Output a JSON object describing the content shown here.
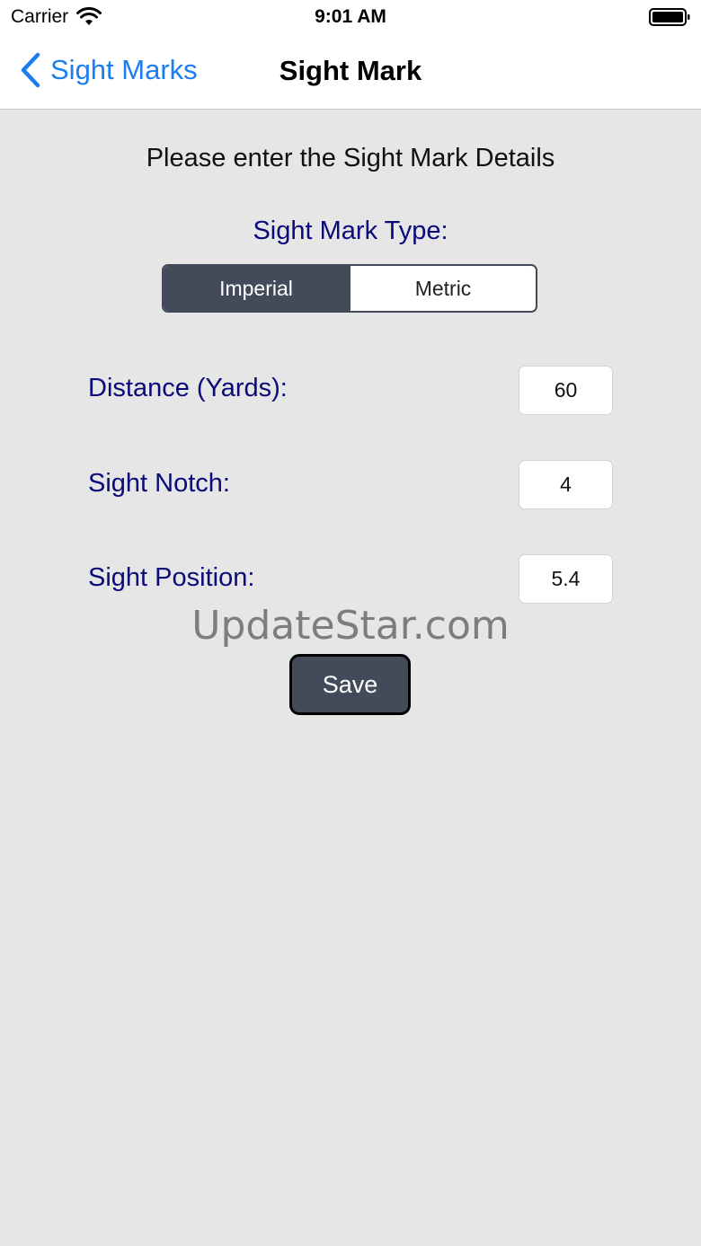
{
  "status_bar": {
    "carrier": "Carrier",
    "time": "9:01 AM"
  },
  "nav": {
    "back_label": "Sight Marks",
    "title": "Sight Mark"
  },
  "form": {
    "heading": "Please enter the Sight Mark Details",
    "type_label": "Sight Mark Type:",
    "segments": [
      {
        "label": "Imperial",
        "selected": true
      },
      {
        "label": "Metric",
        "selected": false
      }
    ],
    "rows": [
      {
        "label": "Distance (Yards):",
        "value": "60"
      },
      {
        "label": "Sight Notch:",
        "value": "4"
      },
      {
        "label": "Sight Position:",
        "value": "5.4"
      }
    ],
    "save_label": "Save"
  },
  "watermark": "UpdateStar.com",
  "colors": {
    "accent_blue": "#1a7df0",
    "label_navy": "#0a0a7a",
    "control_slate": "#434b5b",
    "background": "#e6e6e6"
  }
}
